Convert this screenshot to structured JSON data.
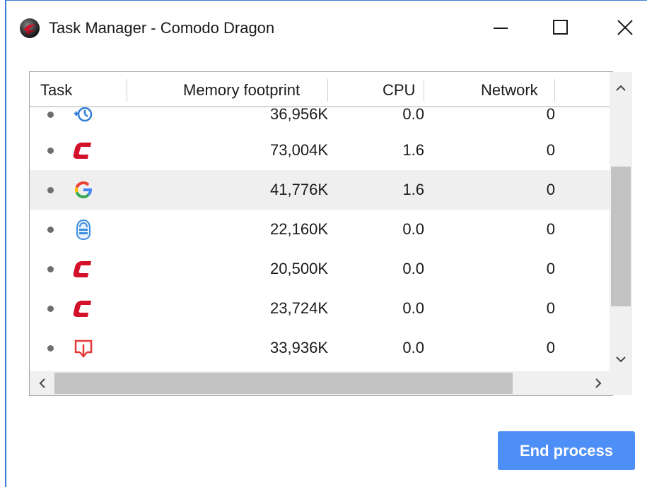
{
  "window": {
    "title": "Task Manager - Comodo Dragon",
    "icon": "comodo-dragon-icon",
    "accent_color": "#3a7fd5"
  },
  "table": {
    "columns": [
      {
        "label": "Task"
      },
      {
        "label": "Memory footprint"
      },
      {
        "label": "CPU"
      },
      {
        "label": "Network"
      }
    ],
    "rows": [
      {
        "icon": "history-clock-icon",
        "memory": "36,956K",
        "cpu": "0.0",
        "network": "0"
      },
      {
        "icon": "comodo-c-icon",
        "memory": "73,004K",
        "cpu": "1.6",
        "network": "0"
      },
      {
        "icon": "google-g-icon",
        "memory": "41,776K",
        "cpu": "1.6",
        "network": "0",
        "selected": true
      },
      {
        "icon": "vpn-shield-icon",
        "memory": "22,160K",
        "cpu": "0.0",
        "network": "0"
      },
      {
        "icon": "comodo-c-icon",
        "memory": "20,500K",
        "cpu": "0.0",
        "network": "0"
      },
      {
        "icon": "comodo-c-icon",
        "memory": "23,724K",
        "cpu": "0.0",
        "network": "0"
      },
      {
        "icon": "media-download-icon",
        "memory": "33,936K",
        "cpu": "0.0",
        "network": "0"
      }
    ]
  },
  "scrollbars": {
    "up_arrow": "^",
    "down_arrow": "v",
    "left_arrow": "<",
    "right_arrow": ">"
  },
  "actions": {
    "end_process_label": "End process",
    "button_color": "#4e8ef7"
  }
}
